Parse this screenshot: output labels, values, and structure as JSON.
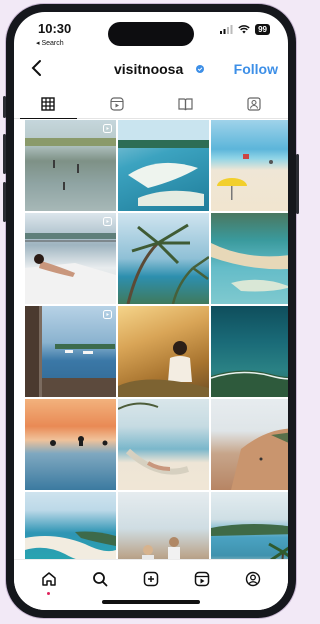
{
  "status": {
    "time": "10:30",
    "back_app": "◂ Search",
    "battery": "99"
  },
  "profile": {
    "username": "visitnoosa",
    "verified": true,
    "follow_label": "Follow"
  },
  "tabs": [
    {
      "name": "posts-grid",
      "active": true
    },
    {
      "name": "reels",
      "active": false
    },
    {
      "name": "guides",
      "active": false
    },
    {
      "name": "tagged",
      "active": false
    }
  ],
  "posts": [
    {
      "subject": "people wading in shallow lagoon",
      "type": "reel"
    },
    {
      "subject": "aerial turquoise river sandbars",
      "type": "photo"
    },
    {
      "subject": "beach with yellow umbrella",
      "type": "photo"
    },
    {
      "subject": "woman relaxing on lounge chair",
      "type": "reel"
    },
    {
      "subject": "pandanus palms over river",
      "type": "photo"
    },
    {
      "subject": "aerial sandbar river mouth",
      "type": "photo"
    },
    {
      "subject": "balcony view of marina",
      "type": "reel"
    },
    {
      "subject": "woman in golden forest",
      "type": "photo"
    },
    {
      "subject": "aerial ocean reef from above",
      "type": "carousel"
    },
    {
      "subject": "sunset surfers in water",
      "type": "photo"
    },
    {
      "subject": "hammock on beach",
      "type": "photo"
    },
    {
      "subject": "sand dunes cliff",
      "type": "photo"
    },
    {
      "subject": "aerial river mouth beach",
      "type": "photo"
    },
    {
      "subject": "family on rocky beach",
      "type": "photo"
    },
    {
      "subject": "coastal headland with palm",
      "type": "photo"
    }
  ],
  "bottom_nav": [
    "home-icon",
    "search-icon",
    "create-icon",
    "reels-icon",
    "profile-icon"
  ],
  "accent_color": "#3d8fe7"
}
